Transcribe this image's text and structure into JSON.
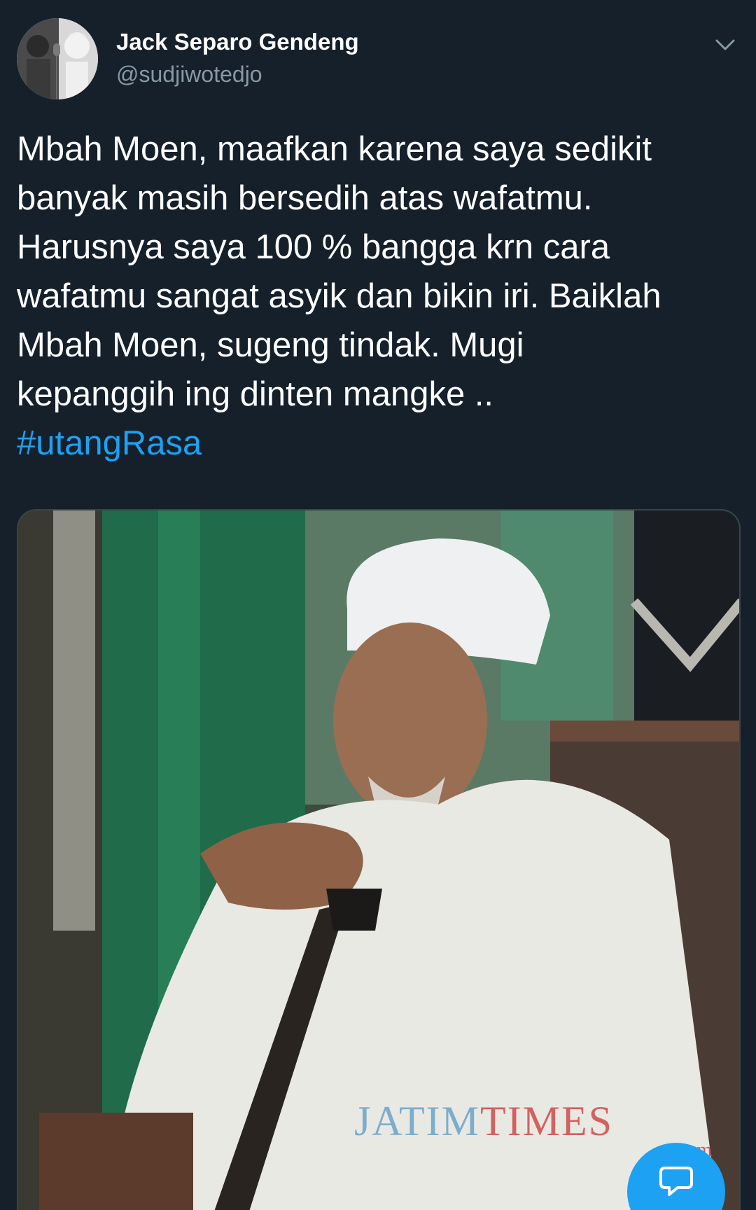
{
  "user": {
    "display_name": "Jack Separo Gendeng",
    "handle": "@sudjiwotedjo"
  },
  "tweet": {
    "text": "Mbah Moen, maafkan karena saya sedikit\nbanyak masih bersedih atas wafatmu.\nHarusnya saya 100 % bangga krn cara\nwafatmu sangat asyik dan bikin iri. Baiklah\nMbah Moen, sugeng tindak. Mugi\nkepanggih ing dinten mangke ..",
    "hashtag": "#utangRasa"
  },
  "media": {
    "watermark_main_a": "JATIM",
    "watermark_main_b": "TIMES",
    "watermark_suffix": ".com"
  },
  "icons": {
    "caret": "chevron-down-icon",
    "reply": "reply-bubble-icon"
  },
  "colors": {
    "background": "#15202b",
    "text": "#ffffff",
    "secondary_text": "#8899a6",
    "link": "#1da1f2",
    "fab": "#1da1f2"
  }
}
